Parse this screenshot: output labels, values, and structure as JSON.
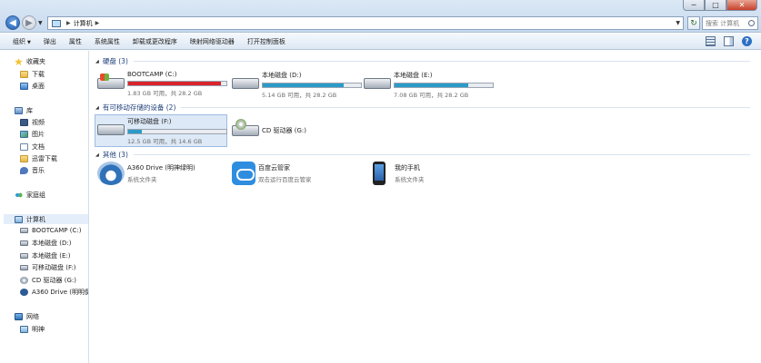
{
  "window": {
    "address_path": "计算机",
    "search_placeholder": "搜索 计算机",
    "controls": {
      "minimize": "─",
      "maximize": "□",
      "close": "✕"
    }
  },
  "toolbar": {
    "items": [
      "组织",
      "弹出",
      "属性",
      "系统属性",
      "卸载或更改程序",
      "映射网络驱动器",
      "打开控制面板"
    ]
  },
  "sidebar": {
    "favorites": {
      "label": "收藏夹",
      "items": [
        "下载",
        "桌面"
      ]
    },
    "libraries": {
      "label": "库",
      "items": [
        "视频",
        "图片",
        "文档",
        "迅雷下载",
        "音乐"
      ]
    },
    "homegroup": "家庭组",
    "computer": {
      "label": "计算机",
      "items": [
        "BOOTCAMP (C:)",
        "本地磁盘 (D:)",
        "本地磁盘 (E:)",
        "可移动磁盘 (F:)",
        "CD 驱动器 (G:)",
        "A360 Drive (明明倒月"
      ]
    },
    "network": {
      "label": "网络",
      "items": [
        "明神"
      ]
    }
  },
  "content": {
    "groups": {
      "hdd": "硬盘 (3)",
      "removable": "有可移动存储的设备 (2)",
      "other": "其他 (3)"
    },
    "drives": [
      {
        "name": "BOOTCAMP (C:)",
        "info": "1.83 GB 可用，共 28.2 GB",
        "used_fraction": 0.94,
        "color": "#d9242c"
      },
      {
        "name": "本地磁盘 (D:)",
        "info": "5.14 GB 可用，共 28.2 GB",
        "used_fraction": 0.82,
        "color": "#2a9bc8"
      },
      {
        "name": "本地磁盘 (E:)",
        "info": "7.08 GB 可用，共 28.2 GB",
        "used_fraction": 0.75,
        "color": "#2a9bc8"
      }
    ],
    "removable": [
      {
        "name": "可移动磁盘 (F:)",
        "info": "12.5 GB 可用，共 14.6 GB",
        "used_fraction": 0.14,
        "color": "#2a9bc8"
      },
      {
        "name": "CD 驱动器 (G:)"
      }
    ],
    "other": [
      {
        "name": "A360 Drive (明神绿明)",
        "sub": "系统文件夹"
      },
      {
        "name": "百度云管家",
        "sub": "双击运行百度云管家"
      },
      {
        "name": "我的手机",
        "sub": "系统文件夹"
      }
    ]
  }
}
